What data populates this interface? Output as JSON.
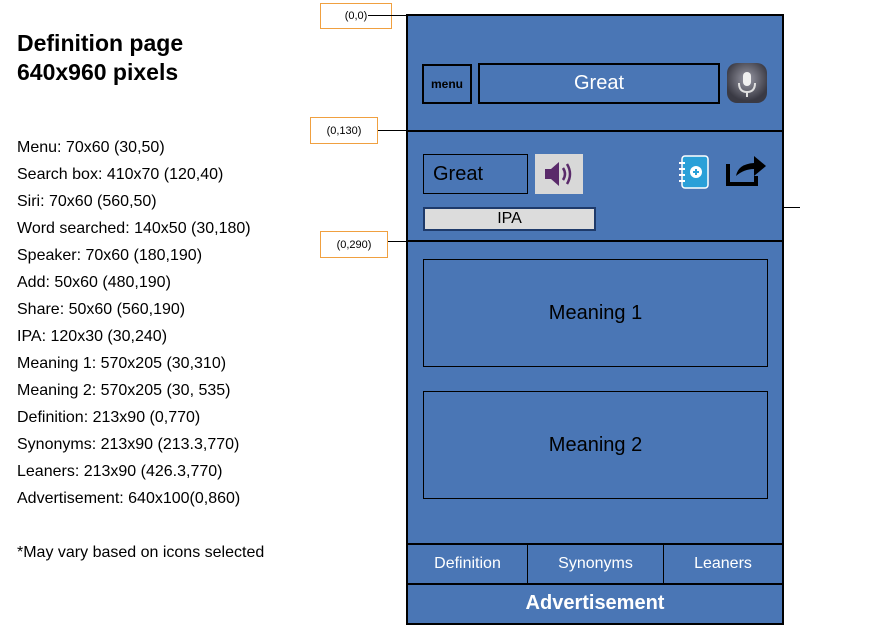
{
  "annotations": {
    "title_line1": "Definition page",
    "title_line2": "640x960 pixels",
    "specs": [
      "Menu: 70x60 (30,50)",
      "Search box: 410x70 (120,40)",
      "Siri:  70x60 (560,50)",
      "Word searched: 140x50 (30,180)",
      "Speaker: 70x60 (180,190)",
      "Add: 50x60 (480,190)",
      "Share:  50x60 (560,190)",
      "IPA: 120x30 (30,240)",
      "Meaning 1: 570x205 (30,310)",
      "Meaning 2: 570x205 (30, 535)",
      "Definition: 213x90 (0,770)",
      "Synonyms: 213x90 (213.3,770)",
      "Leaners:  213x90 (426.3,770)",
      "Advertisement: 640x100(0,860)"
    ],
    "note": "*May vary based on icons selected",
    "coord_labels": [
      "(0,0)",
      "(0,130)",
      "(0,290)"
    ]
  },
  "mockup": {
    "menu_label": "menu",
    "search_value": "Great",
    "siri_icon": "microphone-icon",
    "word": "Great",
    "speaker_icon": "speaker-icon",
    "add_icon": "add-notebook-icon",
    "share_icon": "share-icon",
    "ipa": "IPA",
    "meaning1": "Meaning 1",
    "meaning2": "Meaning 2",
    "tabs": [
      "Definition",
      "Synonyms",
      "Leaners"
    ],
    "advertisement": "Advertisement"
  },
  "colors": {
    "phone_bg": "#4a76b5",
    "coord_border": "#f0a040"
  }
}
